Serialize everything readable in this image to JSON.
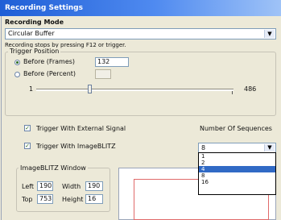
{
  "window": {
    "title": "Recording Settings"
  },
  "recording_mode": {
    "label": "Recording Mode",
    "selected": "Circular Buffer",
    "hint": "Recording stops by pressing F12 or trigger."
  },
  "trigger_position": {
    "title": "Trigger Position",
    "before_frames_label": "Before (Frames)",
    "before_frames_value": "132",
    "before_percent_label": "Before (Percent)",
    "before_percent_value": "",
    "slider_min": "1",
    "slider_max": "486",
    "slider_value_fraction": 0.27
  },
  "options": {
    "external_signal_label": "Trigger With External Signal",
    "external_signal_checked": true,
    "imageblitz_label": "Trigger With ImageBLITZ",
    "imageblitz_checked": true
  },
  "sequences": {
    "label": "Number Of Sequences",
    "selected": "8",
    "options": [
      "1",
      "2",
      "4",
      "8",
      "16"
    ],
    "highlighted_index": 2
  },
  "imageblitz_window": {
    "title": "ImageBLITZ Window",
    "left_label": "Left",
    "left_value": "190",
    "width_label": "Width",
    "width_value": "190",
    "top_label": "Top",
    "top_value": "753",
    "height_label": "Height",
    "height_value": "16"
  },
  "colors": {
    "titlebar": "#1f5fd6",
    "dialog_bg": "#ece9d8",
    "selection": "#316ac5",
    "preview_outline": "#e06a6a"
  }
}
